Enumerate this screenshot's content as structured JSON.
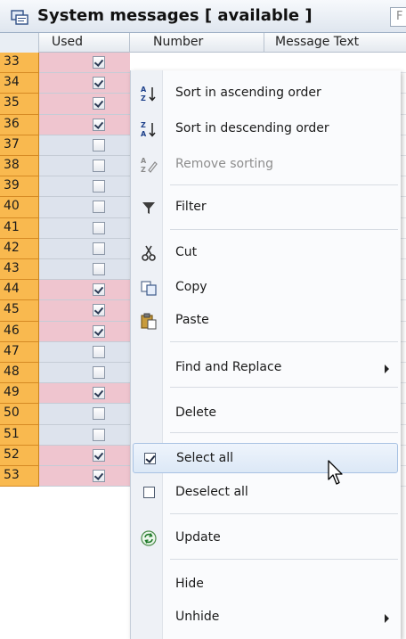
{
  "window": {
    "title": "System messages [ available ]",
    "filter_hint": "F"
  },
  "columns": {
    "used": "Used",
    "number": "Number",
    "message_text": "Message Text"
  },
  "rows": [
    {
      "num": "33",
      "used": true
    },
    {
      "num": "34",
      "used": true
    },
    {
      "num": "35",
      "used": true
    },
    {
      "num": "36",
      "used": true
    },
    {
      "num": "37",
      "used": false
    },
    {
      "num": "38",
      "used": false
    },
    {
      "num": "39",
      "used": false
    },
    {
      "num": "40",
      "used": false
    },
    {
      "num": "41",
      "used": false
    },
    {
      "num": "42",
      "used": false
    },
    {
      "num": "43",
      "used": false
    },
    {
      "num": "44",
      "used": true
    },
    {
      "num": "45",
      "used": true
    },
    {
      "num": "46",
      "used": true
    },
    {
      "num": "47",
      "used": false
    },
    {
      "num": "48",
      "used": false
    },
    {
      "num": "49",
      "used": true
    },
    {
      "num": "50",
      "used": false
    },
    {
      "num": "51",
      "used": false
    },
    {
      "num": "52",
      "used": true
    },
    {
      "num": "53",
      "used": true
    }
  ],
  "context_menu": {
    "sort_asc": "Sort in ascending order",
    "sort_desc": "Sort in descending order",
    "remove_sort": "Remove sorting",
    "filter": "Filter",
    "cut": "Cut",
    "copy": "Copy",
    "paste": "Paste",
    "find_replace": "Find and Replace",
    "delete": "Delete",
    "select_all": "Select all",
    "deselect_all": "Deselect all",
    "update": "Update",
    "hide": "Hide",
    "unhide": "Unhide"
  },
  "colors": {
    "row_number_bg": "#f9b94f",
    "used_on_bg": "#efc5cf",
    "used_off_bg": "#dde3ed",
    "menu_hover": "#dce8f6"
  }
}
